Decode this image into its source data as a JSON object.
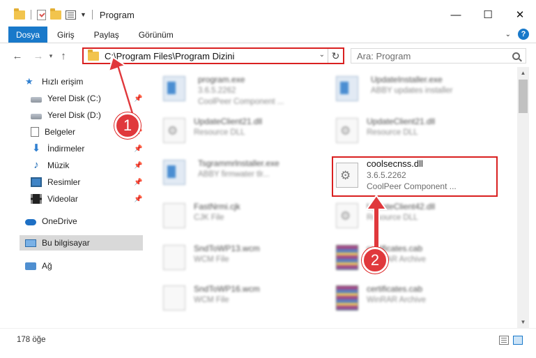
{
  "window": {
    "title": "Program",
    "controls": {
      "minimize": "—",
      "maximize": "☐",
      "close": "✕"
    }
  },
  "ribbon": {
    "tabs": [
      "Dosya",
      "Giriş",
      "Paylaş",
      "Görünüm"
    ],
    "help": "?"
  },
  "nav": {
    "back": "←",
    "forward": "→",
    "recent": "▾",
    "up": "↑",
    "address": "C:\\Program Files\\Program Dizini",
    "refresh": "↻",
    "search_placeholder": "Ara: Program"
  },
  "sidebar": {
    "items": [
      {
        "label": "Hızlı erişim",
        "icon": "star-icon",
        "pinned": false
      },
      {
        "label": "Yerel Disk (C:)",
        "icon": "disk-icon",
        "pinned": true
      },
      {
        "label": "Yerel Disk (D:)",
        "icon": "disk-icon",
        "pinned": false
      },
      {
        "label": "Belgeler",
        "icon": "documents-icon",
        "pinned": true
      },
      {
        "label": "İndirmeler",
        "icon": "download-icon",
        "pinned": true
      },
      {
        "label": "Müzik",
        "icon": "music-icon",
        "pinned": true
      },
      {
        "label": "Resimler",
        "icon": "pictures-icon",
        "pinned": true
      },
      {
        "label": "Videolar",
        "icon": "videos-icon",
        "pinned": true
      },
      {
        "label": "OneDrive",
        "icon": "onedrive-icon",
        "pinned": false
      },
      {
        "label": "Bu bilgisayar",
        "icon": "computer-icon",
        "pinned": false,
        "selected": true
      },
      {
        "label": "Ağ",
        "icon": "network-icon",
        "pinned": false
      }
    ],
    "pin_glyph": "📌"
  },
  "files": [
    {
      "name": "program.exe",
      "line2": "3.6.5.2262",
      "line3": "CoolPeer Component ...",
      "icon": "exe-file-icon"
    },
    {
      "name": "UpdateInstaller.exe",
      "line2": "ABBY updates installer",
      "line3": "",
      "icon": "exe-file-icon"
    },
    {
      "name": "UpdateClient21.dll",
      "line2": "Resource DLL",
      "line3": "",
      "icon": "dll-file-icon"
    },
    {
      "name": "UpdateClient21.dll",
      "line2": "Resource DLL",
      "line3": "",
      "icon": "dll-file-icon"
    },
    {
      "name": "Tsgrammrlnstaller.exe",
      "line2": "ABBY firmwater tlr...",
      "line3": "",
      "icon": "exe-file-icon"
    },
    {
      "name": "coolsecnss.dll",
      "line2": "3.6.5.2262",
      "line3": "CoolPeer Component ...",
      "icon": "dll-file-icon",
      "highlighted": true
    },
    {
      "name": "FastNrmi.cjk",
      "line2": "CJK File",
      "line3": "",
      "icon": "generic-file-icon"
    },
    {
      "name": "UpdateClient42.dll",
      "line2": "Resource DLL",
      "line3": "",
      "icon": "dll-file-icon"
    },
    {
      "name": "SndToWP13.wcm",
      "line2": "WCM File",
      "line3": "",
      "icon": "generic-file-icon"
    },
    {
      "name": "certificates.cab",
      "line2": "WinRAR Archive",
      "line3": "",
      "icon": "archive-icon"
    },
    {
      "name": "SndToWP16.wcm",
      "line2": "WCM File",
      "line3": "",
      "icon": "generic-file-icon"
    },
    {
      "name": "certificates.cab",
      "line2": "WinRAR Archive",
      "line3": "",
      "icon": "archive-icon"
    }
  ],
  "status": {
    "item_count": "178 öğe"
  },
  "annotations": [
    {
      "number": "1",
      "color": "#e0383c"
    },
    {
      "number": "2",
      "color": "#e0383c"
    }
  ]
}
